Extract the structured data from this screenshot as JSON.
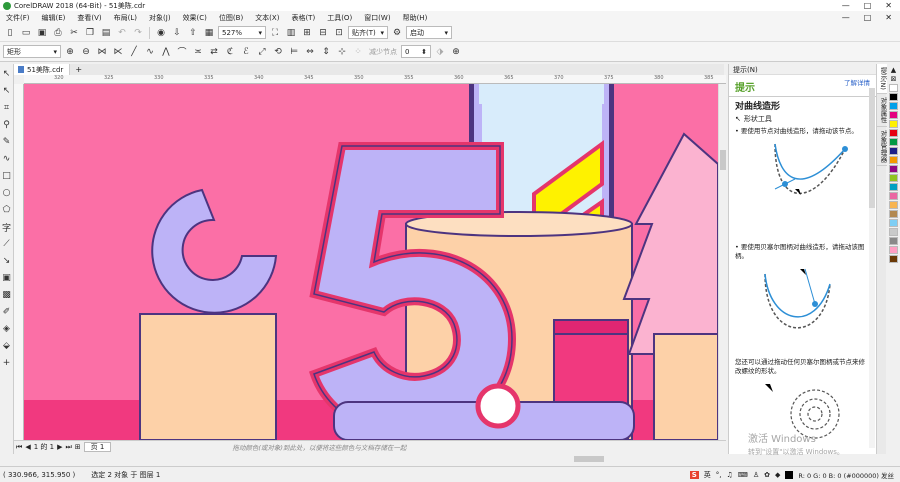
{
  "window": {
    "title": "CorelDRAW 2018 (64-Bit) - 51美陈.cdr",
    "controls": [
      "—",
      "□",
      "✕"
    ]
  },
  "menu": {
    "items": [
      "文件(F)",
      "编辑(E)",
      "查看(V)",
      "布局(L)",
      "对象(J)",
      "效果(C)",
      "位图(B)",
      "文本(X)",
      "表格(T)",
      "工具(O)",
      "窗口(W)",
      "帮助(H)"
    ],
    "doc_controls": [
      "—",
      "□",
      "✕"
    ]
  },
  "toolbar1": {
    "zoom": "527%",
    "snap_label": "贴齐(T)",
    "launch_label": "启动"
  },
  "toolbar2": {
    "shape_select": "矩形",
    "reduce_nodes": "减少节点",
    "smoothness": "0"
  },
  "document": {
    "tab_name": "51美陈.cdr"
  },
  "ruler": {
    "h_ticks": [
      "320",
      "325",
      "330",
      "335",
      "340",
      "345",
      "350",
      "355",
      "360",
      "365",
      "370",
      "375",
      "380",
      "385"
    ]
  },
  "pages": {
    "counter": "1 的 1",
    "page_tab": "页 1",
    "hint": "拖动颜色(或对象)到此处，以便将这些颜色与文档存储在一起"
  },
  "hints": {
    "panel_title": "提示(N)",
    "title": "提示",
    "learn_more": "了解详情",
    "section": "对曲线造形",
    "tool": "形状工具",
    "bullet1": "• 要使用节点对曲线造形，请拖动该节点。",
    "bullet2": "• 要使用贝塞尔图柄对曲线造形，请拖动该图柄。",
    "para3": "您还可以通过拖动任何贝塞尔图柄或节点来修改螺纹的形状。"
  },
  "dock": {
    "tabs": [
      "提示(N)",
      "对象属性",
      "对象管理器"
    ]
  },
  "palette": {
    "colors": [
      "#ffffff",
      "#000000",
      "#00a0e9",
      "#e4007f",
      "#fff100",
      "#e60012",
      "#009944",
      "#1d2088",
      "#f39800",
      "#920783",
      "#8fc31f",
      "#00a0c1",
      "#ea68a2",
      "#f8b551",
      "#b28850",
      "#7ecef4",
      "#c9caca",
      "#898989",
      "#ff9ec2",
      "#6a3906"
    ]
  },
  "status": {
    "coords": "( 330.966, 315.950 )",
    "selection": "选定 2 对象 于 图层 1",
    "color_readout": "R: 0 G: 0 B: 0 (#000000) 发丝",
    "ime": "英"
  },
  "watermark": {
    "line1": "激活 Windows",
    "line2": "转到\"设置\"以激活 Windows。"
  }
}
